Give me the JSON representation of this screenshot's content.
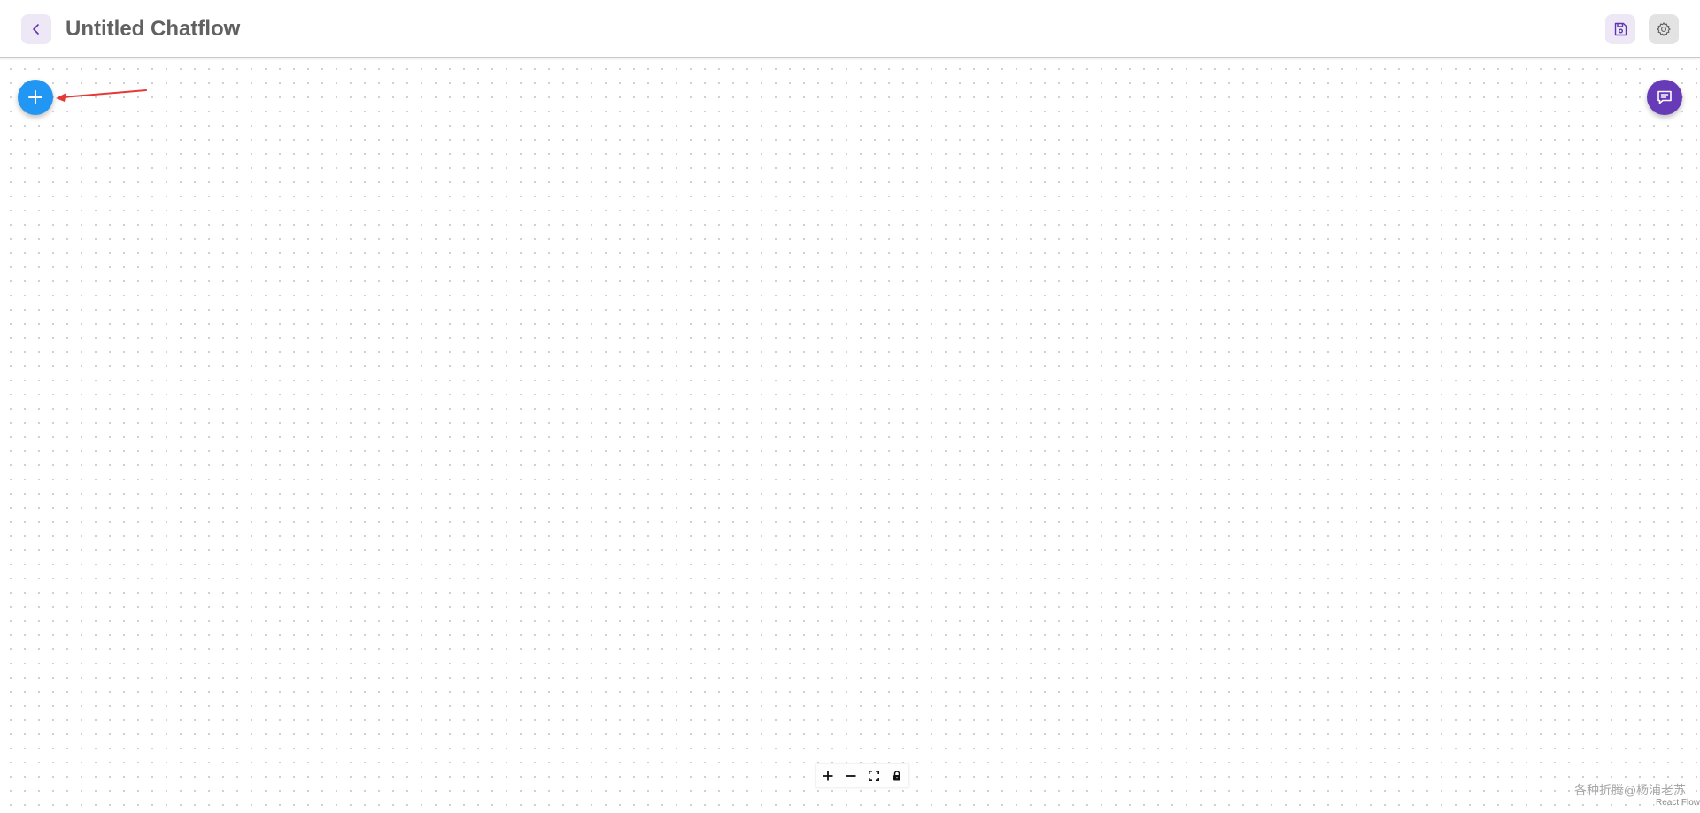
{
  "header": {
    "title": "Untitled Chatflow",
    "back_icon": "chevron-left-icon",
    "save_icon": "save-icon",
    "settings_icon": "gear-icon"
  },
  "canvas": {
    "add_node_icon": "plus-icon",
    "chat_icon": "chat-message-icon",
    "annotation_arrow_color": "#e53935"
  },
  "controls": {
    "zoom_in_icon": "plus-icon",
    "zoom_out_icon": "minus-icon",
    "fit_view_icon": "fit-view-icon",
    "lock_icon": "lock-icon"
  },
  "watermark": "各种折腾@杨浦老苏",
  "attribution": "React Flow",
  "colors": {
    "primary_blue": "#2196f3",
    "primary_purple": "#673ab7",
    "soft_purple": "#ede7f6",
    "title_gray": "#616161"
  }
}
